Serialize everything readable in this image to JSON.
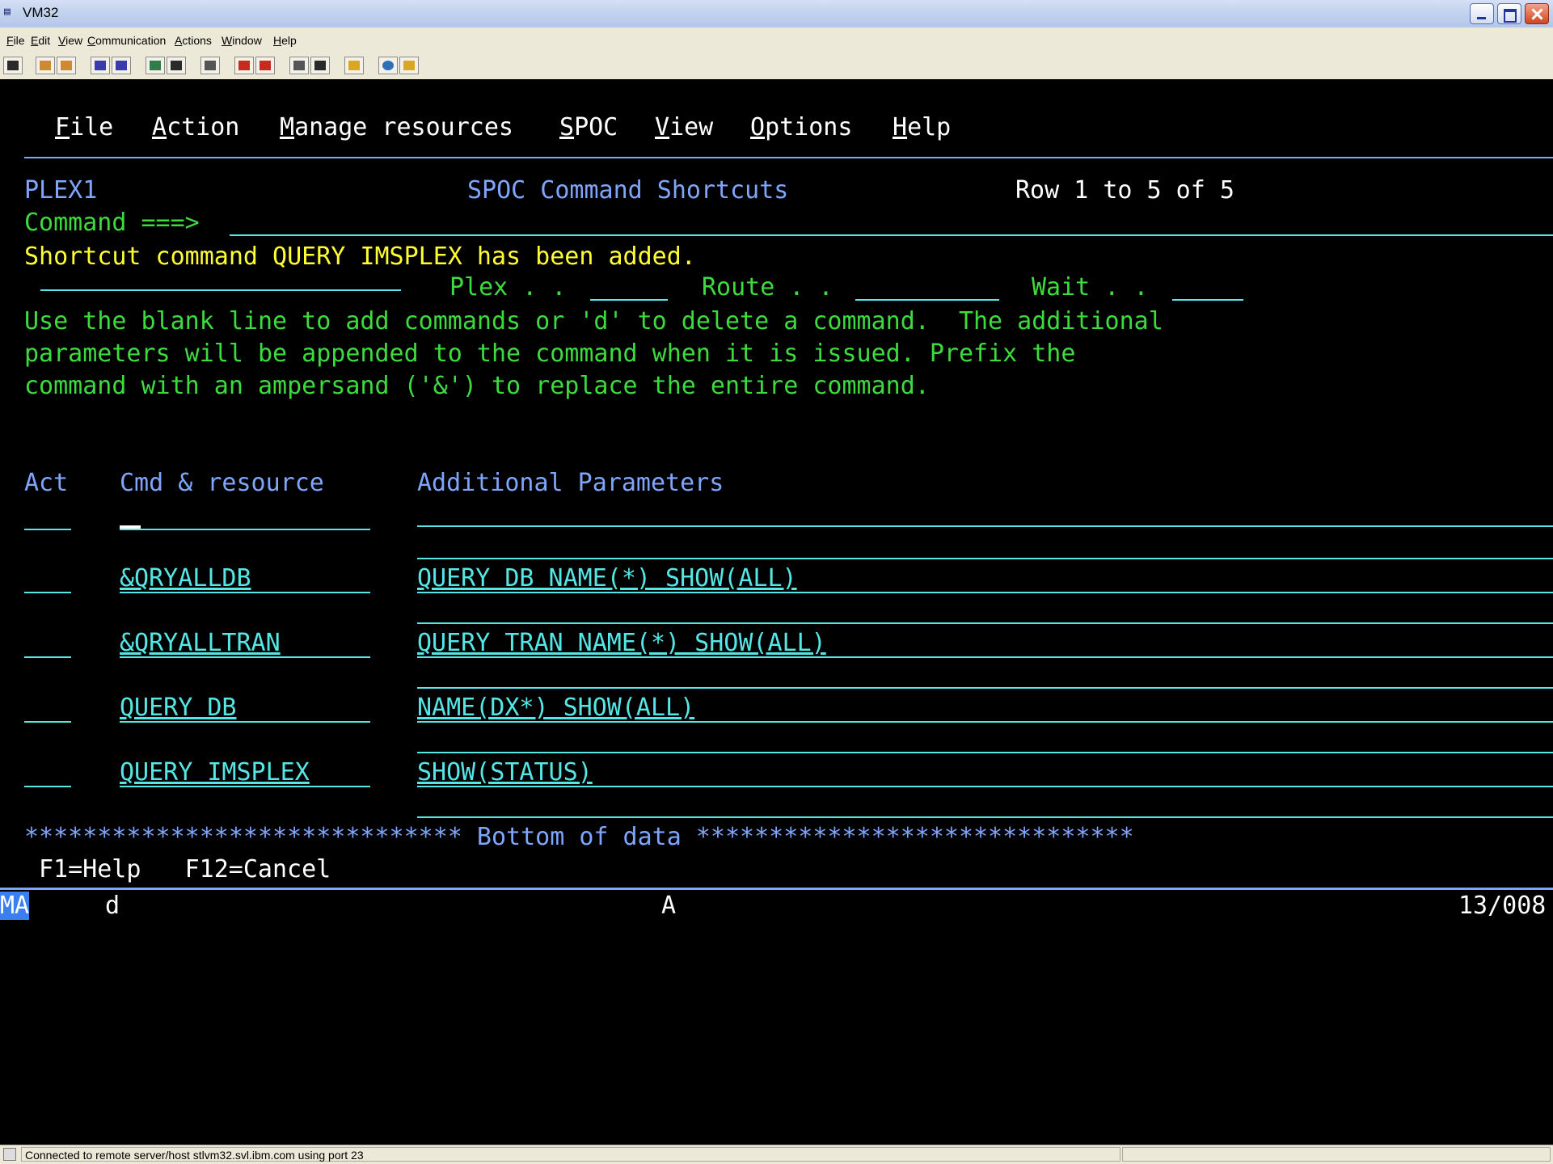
{
  "window": {
    "title": "VM32",
    "icon": "terminal-app-icon"
  },
  "app_menu": [
    "File",
    "Edit",
    "View",
    "Communication",
    "Actions",
    "Window",
    "Help"
  ],
  "toolbar_icons": [
    "display-icon",
    "copy-icon",
    "paste-icon",
    "send-icon",
    "receive-icon",
    "macro-icon",
    "record-icon",
    "print-icon",
    "file-transfer-send-icon",
    "file-transfer-receive-icon",
    "play-icon",
    "stop-icon",
    "clipboard-icon",
    "globe-icon",
    "keyboard-icon"
  ],
  "terminal": {
    "actionbar": [
      "File",
      "Action",
      "Manage resources",
      "SPOC",
      "View",
      "Options",
      "Help"
    ],
    "header": {
      "plex": "PLEX1",
      "title": "SPOC Command Shortcuts",
      "row_info": "Row 1 to 5 of 5"
    },
    "command_label": "Command ===>",
    "message": "Shortcut command QUERY IMSPLEX has been added.",
    "params": {
      "plex": "Plex . .",
      "route": "Route . .",
      "wait": "Wait . ."
    },
    "instructions": [
      "Use the blank line to add commands or 'd' to delete a command.  The additional",
      "parameters will be appended to the command when it is issued. Prefix the",
      "command with an ampersand ('&') to replace the entire command."
    ],
    "columns": {
      "act": "Act",
      "cmd": "Cmd & resource",
      "params": "Additional Parameters"
    },
    "rows": [
      {
        "cmd": "&QRYALLDB",
        "params": "QUERY DB NAME(*) SHOW(ALL)"
      },
      {
        "cmd": "&QRYALLTRAN",
        "params": "QUERY TRAN NAME(*) SHOW(ALL)"
      },
      {
        "cmd": "QUERY DB",
        "params": "NAME(DX*) SHOW(ALL)"
      },
      {
        "cmd": "QUERY IMSPLEX",
        "params": "SHOW(STATUS)"
      }
    ],
    "bottom": "****************************** Bottom of data ******************************",
    "fkeys": "F1=Help   F12=Cancel",
    "oia": {
      "ma": "MA",
      "char": "d",
      "mode": "A",
      "cursor_pos": "13/008"
    }
  },
  "status": "Connected to remote server/host stlvm32.svl.ibm.com using port 23"
}
